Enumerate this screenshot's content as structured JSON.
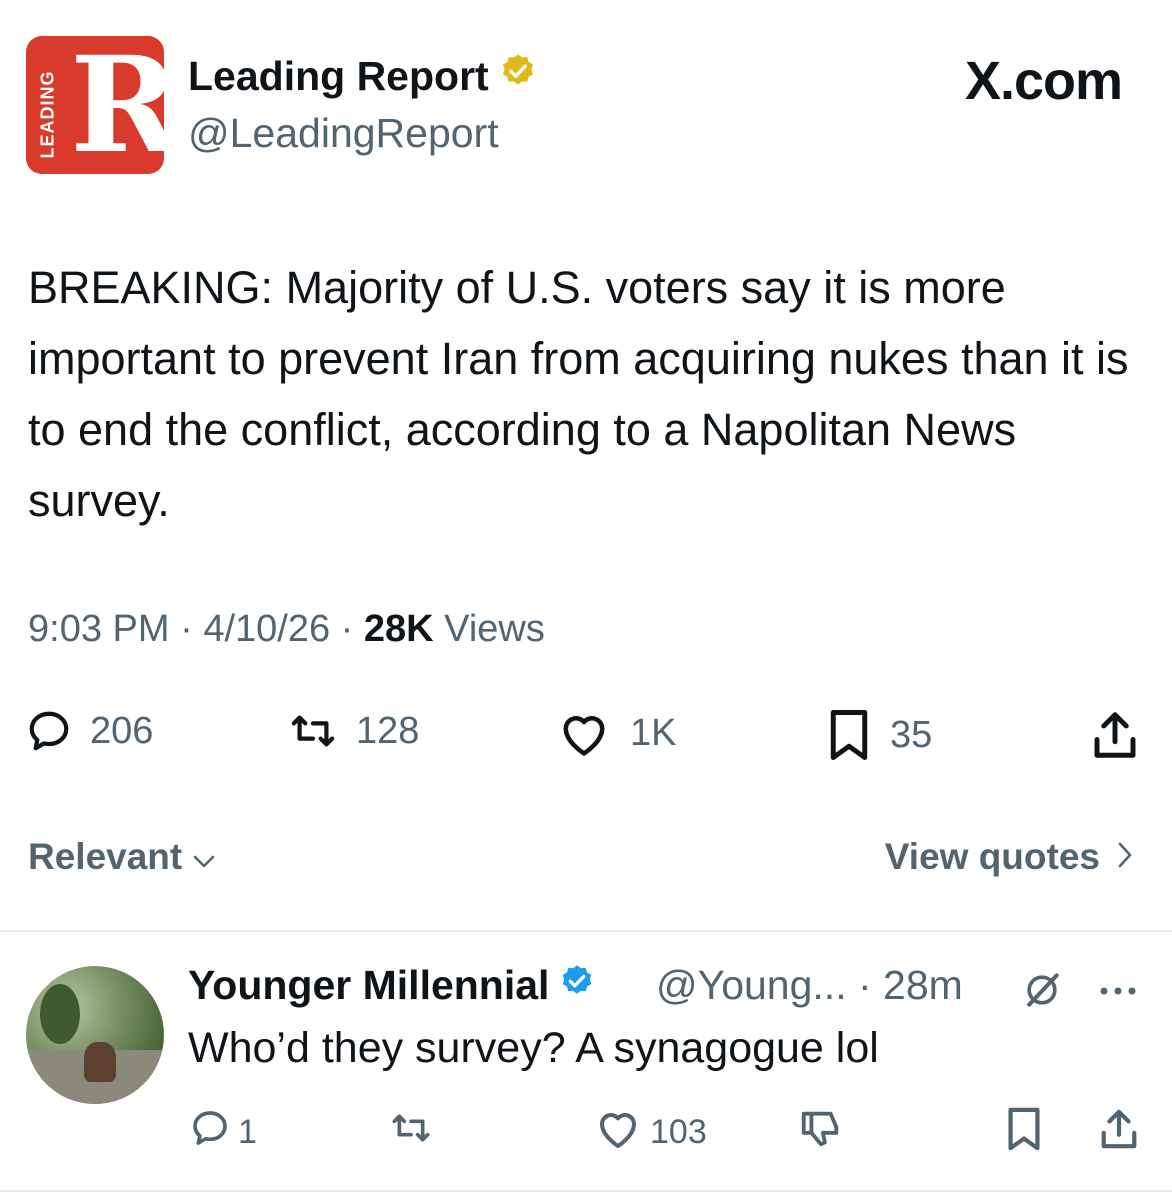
{
  "header": {
    "logo_text": "R",
    "logo_vertical_text": "LEADING",
    "display_name": "Leading Report",
    "handle": "@LeadingReport",
    "site": "X.com"
  },
  "tweet": {
    "text": "BREAKING: Majority of U.S. voters say it is more important to prevent Iran from acquiring nukes than it is to end the conflict, according to a Napolitan News survey.",
    "time": "9:03 PM",
    "date": "4/10/26",
    "views_count": "28K",
    "views_label": "Views",
    "sep": "·"
  },
  "actions": {
    "replies": "206",
    "reposts": "128",
    "likes": "1K",
    "bookmarks": "35"
  },
  "sort": {
    "label": "Relevant",
    "view_quotes": "View quotes"
  },
  "reply": {
    "display_name": "Younger Millennial",
    "handle_time": "@Young... · 28m",
    "text": "Who’d they survey? A synagogue lol",
    "replies": "1",
    "likes": "103"
  },
  "colors": {
    "text": "#0f1419",
    "secondary": "#536471",
    "brand_red": "#d93a2b",
    "verified_gold": "#e2b719",
    "verified_blue": "#1d9bf0"
  }
}
